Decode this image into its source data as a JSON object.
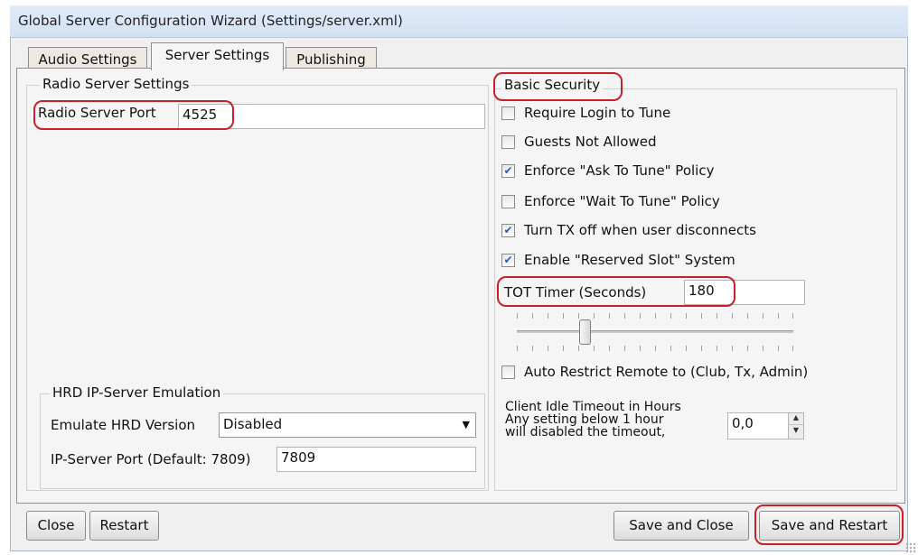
{
  "window": {
    "title": "Global Server Configuration Wizard (Settings/server.xml)"
  },
  "tabs": [
    {
      "label": "Audio Settings",
      "active": false
    },
    {
      "label": "Server Settings",
      "active": true
    },
    {
      "label": "Publishing",
      "active": false
    }
  ],
  "radio_server": {
    "group_title": "Radio Server Settings",
    "port_label": "Radio Server Port",
    "port_value": "4525"
  },
  "hrd": {
    "group_title": "HRD IP-Server Emulation",
    "emulate_label": "Emulate HRD Version",
    "emulate_value": "Disabled",
    "port_label": "IP-Server Port (Default: 7809)",
    "port_value": "7809"
  },
  "security": {
    "group_title": "Basic Security",
    "options": [
      {
        "label": "Require Login to Tune",
        "checked": false
      },
      {
        "label": "Guests Not Allowed",
        "checked": false
      },
      {
        "label": "Enforce \"Ask To Tune\" Policy",
        "checked": true
      },
      {
        "label": "Enforce \"Wait To Tune\" Policy",
        "checked": false
      },
      {
        "label": "Turn TX off when user disconnects",
        "checked": true
      },
      {
        "label": "Enable \"Reserved Slot\" System",
        "checked": true
      }
    ],
    "tot_label": "TOT Timer (Seconds)",
    "tot_value": "180",
    "auto_restrict_label": "Auto Restrict Remote to (Club, Tx, Admin)",
    "auto_restrict_checked": false,
    "idle_label_line1": "Client Idle Timeout in Hours",
    "idle_label_line2": "Any setting below 1 hour",
    "idle_label_line3": "will disabled the timeout,",
    "idle_value": "0,0"
  },
  "buttons": {
    "close": "Close",
    "restart": "Restart",
    "save_close": "Save and Close",
    "save_restart": "Save and Restart"
  },
  "colors": {
    "highlight": "#c8212b",
    "check": "#2a5fb8"
  },
  "icons": {
    "checkmark": "checkmark-icon",
    "dropdown": "chevron-down-icon",
    "spin_up": "arrow-up-icon",
    "spin_down": "arrow-down-icon"
  }
}
